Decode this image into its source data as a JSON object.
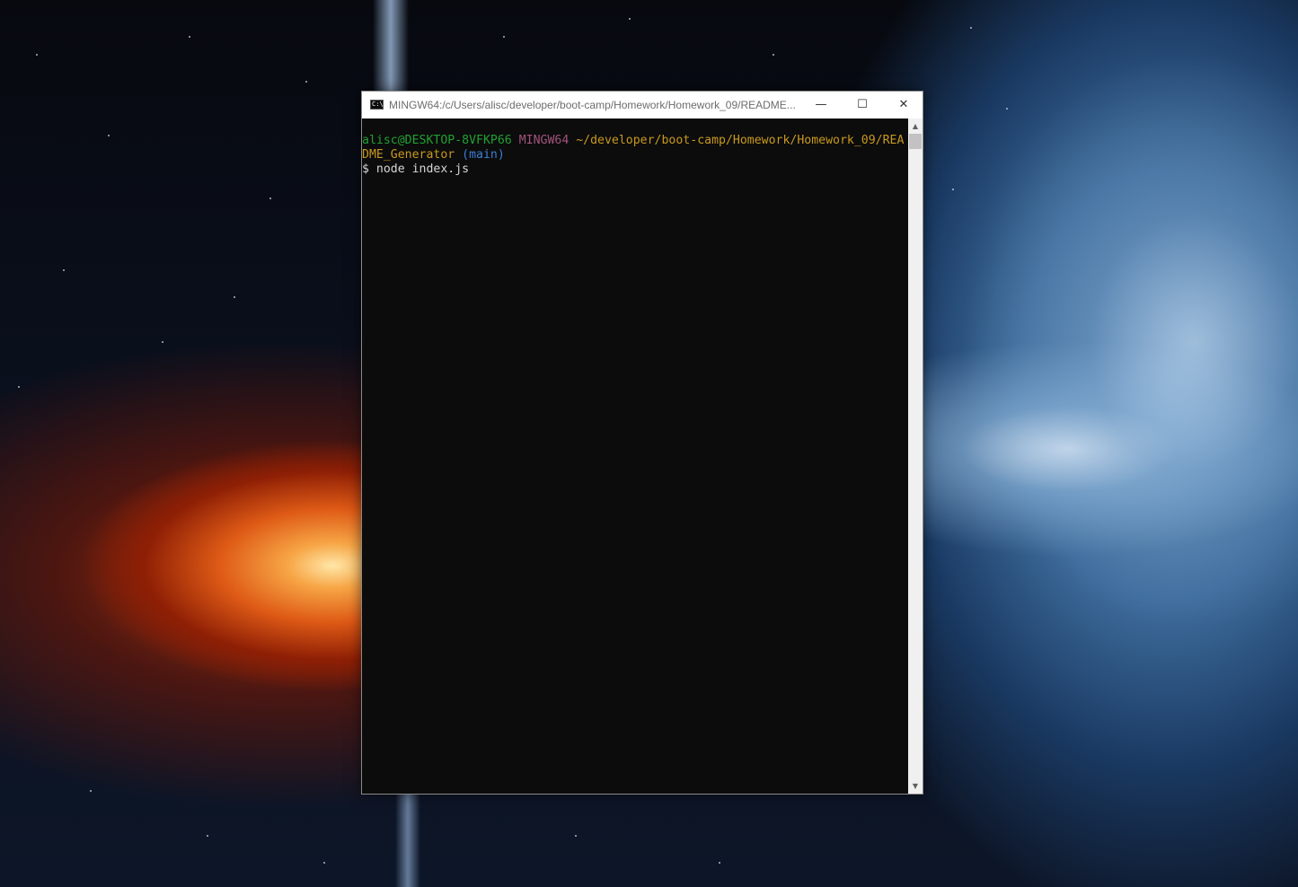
{
  "window": {
    "title": "MINGW64:/c/Users/alisc/developer/boot-camp/Homework/Homework_09/README...",
    "icon": "console-app-icon",
    "icon_text": "C:\\",
    "controls": {
      "minimize": "—",
      "maximize": "☐",
      "close": "✕"
    }
  },
  "terminal": {
    "prompt": {
      "user_host": "alisc@DESKTOP-8VFKP66",
      "system": "MINGW64",
      "path_part1": "~/developer/boot-camp/Homework/Homework_09/REA",
      "path_part2": "DME_Generator",
      "branch": "(main)"
    },
    "command": "$ node index.js"
  },
  "scrollbar": {
    "up_arrow": "▲",
    "down_arrow": "▼"
  },
  "colors": {
    "user_host": "#21a032",
    "system": "#a2537e",
    "path": "#c9991f",
    "branch": "#3d7fd6",
    "console_bg": "#0c0c0c"
  }
}
